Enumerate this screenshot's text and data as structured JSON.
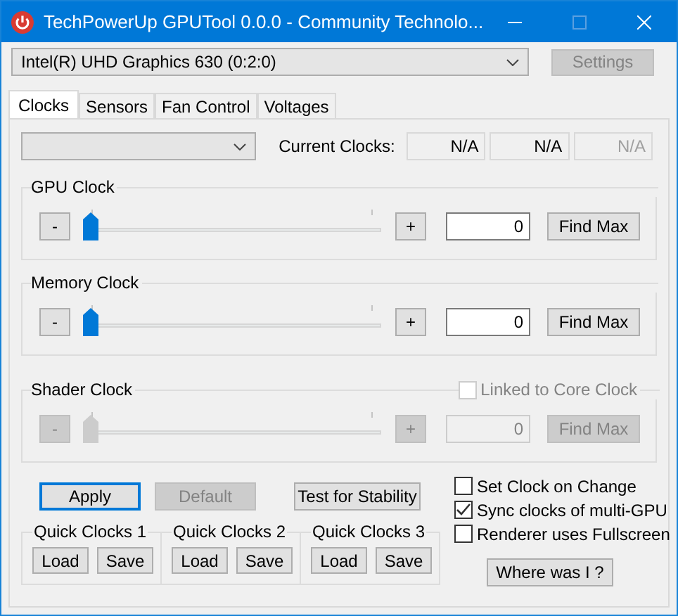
{
  "window": {
    "title": "TechPowerUp GPUTool 0.0.0 - Community Technolo..."
  },
  "device": {
    "value": "Intel(R) UHD Graphics 630 (0:2:0)"
  },
  "settings_button": {
    "label": "Settings",
    "disabled": true
  },
  "tabs": [
    {
      "label": "Clocks",
      "selected": true
    },
    {
      "label": "Sensors",
      "selected": false
    },
    {
      "label": "Fan Control",
      "selected": false
    },
    {
      "label": "Voltages",
      "selected": false
    }
  ],
  "current_clocks": {
    "label": "Current Clocks:",
    "readings": [
      {
        "value": "N/A",
        "disabled": false
      },
      {
        "value": "N/A",
        "disabled": false
      },
      {
        "value": "N/A",
        "disabled": true
      }
    ]
  },
  "clock_groups": [
    {
      "title": "GPU Clock",
      "disabled": false,
      "minus": "-",
      "plus": "+",
      "level": 0,
      "value": "0",
      "button": "Find Max"
    },
    {
      "title": "Memory Clock",
      "disabled": false,
      "minus": "-",
      "plus": "+",
      "level": 0,
      "value": "0",
      "button": "Find Max"
    },
    {
      "title": "Shader Clock",
      "disabled": true,
      "minus": "-",
      "plus": "+",
      "level": 0,
      "value": "0",
      "button": "Find Max",
      "linked": {
        "label": "Linked to Core Clock",
        "checked": false,
        "disabled": true
      }
    }
  ],
  "actions": [
    {
      "label": "Apply",
      "focused": true,
      "disabled": false
    },
    {
      "label": "Default",
      "focused": false,
      "disabled": true
    },
    {
      "label": "Test for Stability",
      "focused": false,
      "disabled": false
    }
  ],
  "quick_clocks": [
    {
      "title": "Quick Clocks 1",
      "buttons": [
        "Load",
        "Save"
      ]
    },
    {
      "title": "Quick Clocks 2",
      "buttons": [
        "Load",
        "Save"
      ]
    },
    {
      "title": "Quick Clocks 3",
      "buttons": [
        "Load",
        "Save"
      ]
    }
  ],
  "options": [
    {
      "label": "Set Clock on Change",
      "checked": false
    },
    {
      "label": "Sync clocks of multi-GPU",
      "checked": true
    },
    {
      "label": "Renderer uses Fullscreen",
      "checked": false
    }
  ],
  "where_button": {
    "label": "Where was I ?"
  }
}
